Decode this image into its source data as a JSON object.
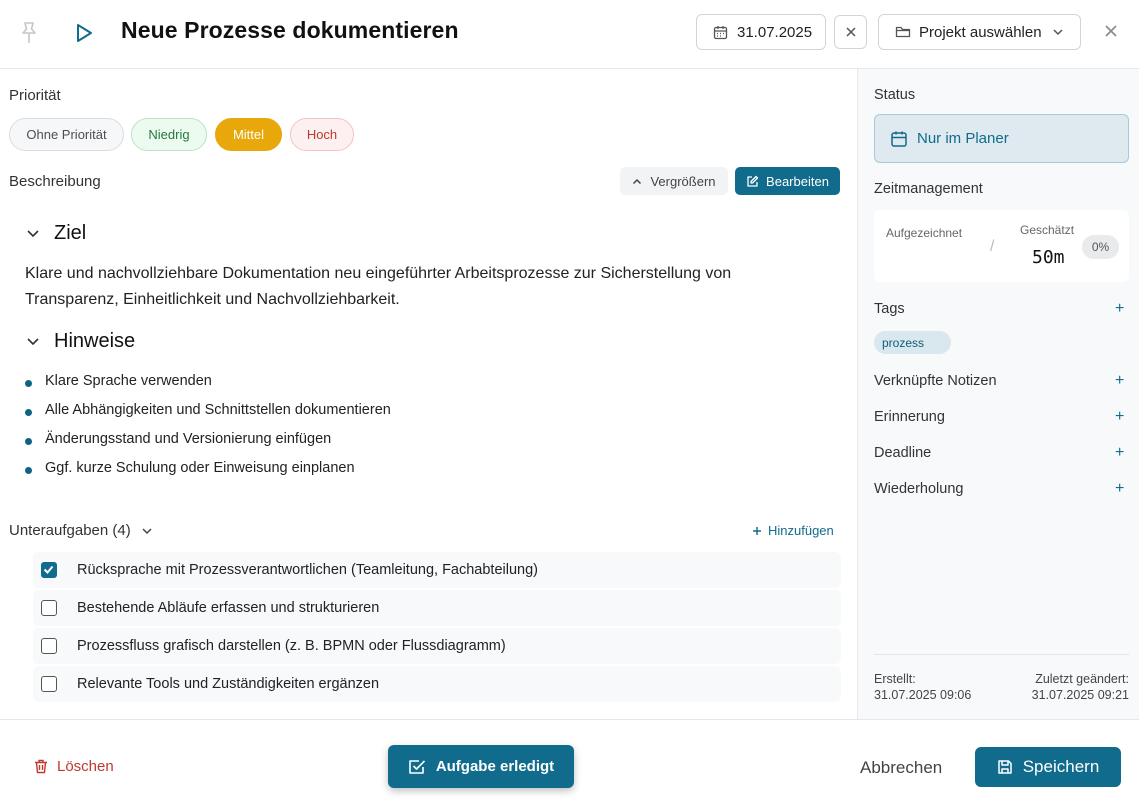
{
  "header": {
    "title": "Neue Prozesse dokumentieren",
    "date": "31.07.2025",
    "project_placeholder": "Projekt auswählen"
  },
  "priority": {
    "label": "Priorität",
    "options": [
      "Ohne Priorität",
      "Niedrig",
      "Mittel",
      "Hoch"
    ],
    "selected": "Mittel"
  },
  "description": {
    "label": "Beschreibung",
    "enlarge_label": "Vergrößern",
    "edit_label": "Bearbeiten",
    "goal_heading": "Ziel",
    "goal_text": "Klare und nachvollziehbare Dokumentation neu eingeführter Arbeitsprozesse zur Sicherstellung von Transparenz, Einheitlichkeit und Nachvollziehbarkeit.",
    "notes_heading": "Hinweise",
    "notes": [
      "Klare Sprache verwenden",
      "Alle Abhängigkeiten und Schnittstellen dokumentieren",
      "Änderungsstand und Versionierung einfügen",
      "Ggf. kurze Schulung oder Einweisung einplanen"
    ]
  },
  "subtasks": {
    "label": "Unteraufgaben (4)",
    "add_label": "Hinzufügen",
    "items": [
      {
        "text": "Rücksprache mit Prozessverantwortlichen (Teamleitung, Fachabteilung)",
        "done": true
      },
      {
        "text": "Bestehende Abläufe erfassen und strukturieren",
        "done": false
      },
      {
        "text": "Prozessfluss grafisch darstellen (z. B. BPMN oder Flussdiagramm)",
        "done": false
      },
      {
        "text": "Relevante Tools und Zuständigkeiten ergänzen",
        "done": false
      }
    ]
  },
  "sidebar": {
    "status_label": "Status",
    "status_value": "Nur im Planer",
    "time_label": "Zeitmanagement",
    "recorded_label": "Aufgezeichnet",
    "estimated_label": "Geschätzt",
    "estimated_value": "50m",
    "progress": "0%",
    "tags_label": "Tags",
    "tags": [
      "prozess"
    ],
    "linked_notes_label": "Verknüpfte Notizen",
    "reminder_label": "Erinnerung",
    "deadline_label": "Deadline",
    "repeat_label": "Wiederholung",
    "created_label": "Erstellt:",
    "created_value": "31.07.2025 09:06",
    "modified_label": "Zuletzt geändert:",
    "modified_value": "31.07.2025 09:21"
  },
  "footer": {
    "delete_label": "Löschen",
    "done_label": "Aufgabe erledigt",
    "cancel_label": "Abbrechen",
    "save_label": "Speichern"
  },
  "colors": {
    "accent": "#106b8c",
    "priority_medium": "#e8a80b",
    "danger": "#c0392b"
  }
}
